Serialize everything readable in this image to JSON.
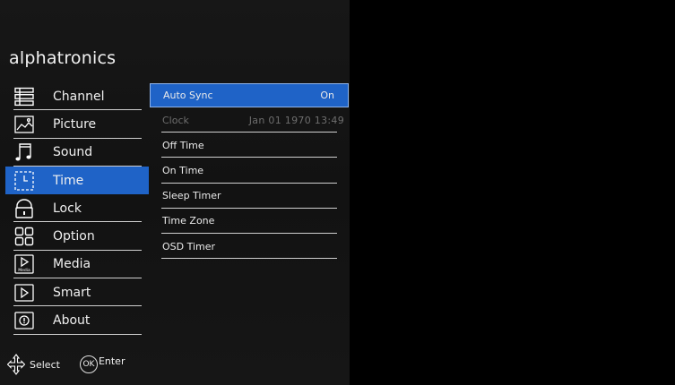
{
  "brand": {
    "name": "alphatronics"
  },
  "sidebar": {
    "items": [
      {
        "label": "Channel",
        "icon": "channel-list-icon"
      },
      {
        "label": "Picture",
        "icon": "picture-icon"
      },
      {
        "label": "Sound",
        "icon": "music-note-icon"
      },
      {
        "label": "Time",
        "icon": "clock-icon",
        "selected": true
      },
      {
        "label": "Lock",
        "icon": "lock-icon"
      },
      {
        "label": "Option",
        "icon": "grid-icon"
      },
      {
        "label": "Media",
        "icon": "media-play-icon",
        "icon_text": "Media"
      },
      {
        "label": "Smart",
        "icon": "smart-play-icon"
      },
      {
        "label": "About",
        "icon": "info-icon"
      }
    ]
  },
  "submenu": {
    "rows": [
      {
        "label": "Auto Sync",
        "value": "On",
        "state": "highlighted"
      },
      {
        "label": "Clock",
        "value": "Jan 01 1970  13:49",
        "state": "disabled"
      },
      {
        "label": "Off Time",
        "value": ""
      },
      {
        "label": "On Time",
        "value": ""
      },
      {
        "label": "Sleep Timer",
        "value": ""
      },
      {
        "label": "Time Zone",
        "value": ""
      },
      {
        "label": "OSD Timer",
        "value": ""
      }
    ]
  },
  "footer": {
    "select_label": "Select",
    "ok_label": "OK",
    "enter_label": "Enter"
  },
  "colors": {
    "highlight": "#1f63c7",
    "panel_bg": "#151515",
    "screen_bg": "#000000",
    "disabled_text": "#6e6e6e"
  }
}
